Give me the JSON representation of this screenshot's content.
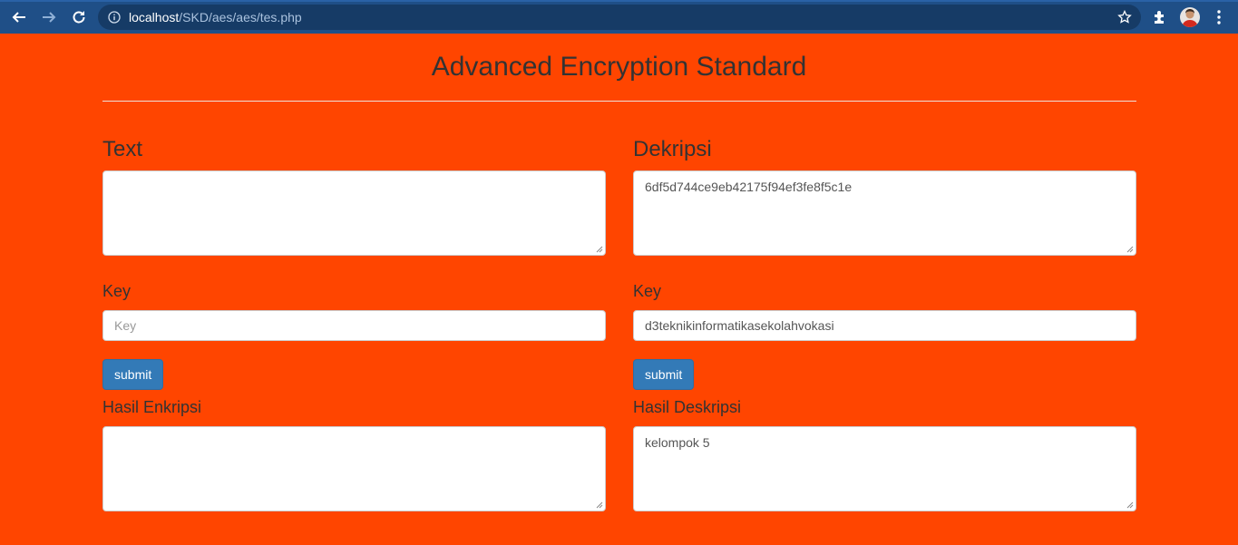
{
  "browser": {
    "url_host": "localhost",
    "url_path": "/SKD/aes/aes/tes.php",
    "icons": [
      "back-arrow-icon",
      "forward-arrow-icon",
      "reload-icon",
      "info-icon",
      "star-icon",
      "extensions-icon",
      "profile-avatar",
      "menu-dots-icon"
    ]
  },
  "page": {
    "title": "Advanced Encryption Standard",
    "background_color": "#ff4500",
    "button_color": "#337ab7"
  },
  "encrypt": {
    "heading": "Text",
    "text_value": "",
    "key_label": "Key",
    "key_value": "",
    "key_placeholder": "Key",
    "submit_label": "submit",
    "result_label": "Hasil Enkripsi",
    "result_value": ""
  },
  "decrypt": {
    "heading": "Dekripsi",
    "text_value": "6df5d744ce9eb42175f94ef3fe8f5c1e",
    "key_label": "Key",
    "key_value": "d3teknikinformatikasekolahvokasi",
    "submit_label": "submit",
    "result_label": "Hasil Deskripsi",
    "result_value": "kelompok 5"
  }
}
